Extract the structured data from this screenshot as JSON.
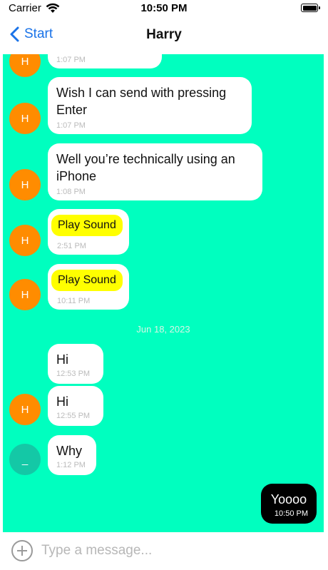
{
  "status_bar": {
    "carrier": "Carrier",
    "time": "10:50 PM"
  },
  "nav": {
    "back_label": "Start",
    "title": "Harry"
  },
  "chat": {
    "date_separator": "Jun 18, 2023",
    "messages": [
      {
        "type": "text",
        "text": "",
        "time": "1:07 PM",
        "avatar": "H"
      },
      {
        "type": "text",
        "text": "Wish I can send with pressing Enter",
        "time": "1:07 PM",
        "avatar": "H"
      },
      {
        "type": "text",
        "text": "Well you’re technically using an iPhone",
        "time": "1:08 PM",
        "avatar": "H"
      },
      {
        "type": "sound",
        "text": "Play Sound",
        "time": "2:51 PM",
        "avatar": "H"
      },
      {
        "type": "sound",
        "text": "Play Sound",
        "time": "10:11 PM",
        "avatar": "H"
      },
      {
        "type": "text",
        "text": "Hi",
        "time": "12:53 PM",
        "avatar": ""
      },
      {
        "type": "text",
        "text": "Hi",
        "time": "12:55 PM",
        "avatar": "H"
      },
      {
        "type": "text",
        "text": "Why",
        "time": "1:12 PM",
        "avatar": "_"
      },
      {
        "type": "outgoing",
        "text": "Yoooo",
        "time": "10:50 PM",
        "avatar": ""
      }
    ]
  },
  "input": {
    "placeholder": "Type a message...",
    "value": ""
  },
  "colors": {
    "chat_background": "#00ffbf",
    "avatar_orange": "#ff8c00",
    "avatar_teal": "#14c8a6",
    "sound_button": "#ffff00",
    "link_blue": "#1a73e8",
    "outgoing_bubble": "#000000"
  },
  "icons": {
    "wifi": "wifi-icon",
    "battery": "battery-icon",
    "back": "chevron-left-icon",
    "add": "plus-circle-icon"
  }
}
